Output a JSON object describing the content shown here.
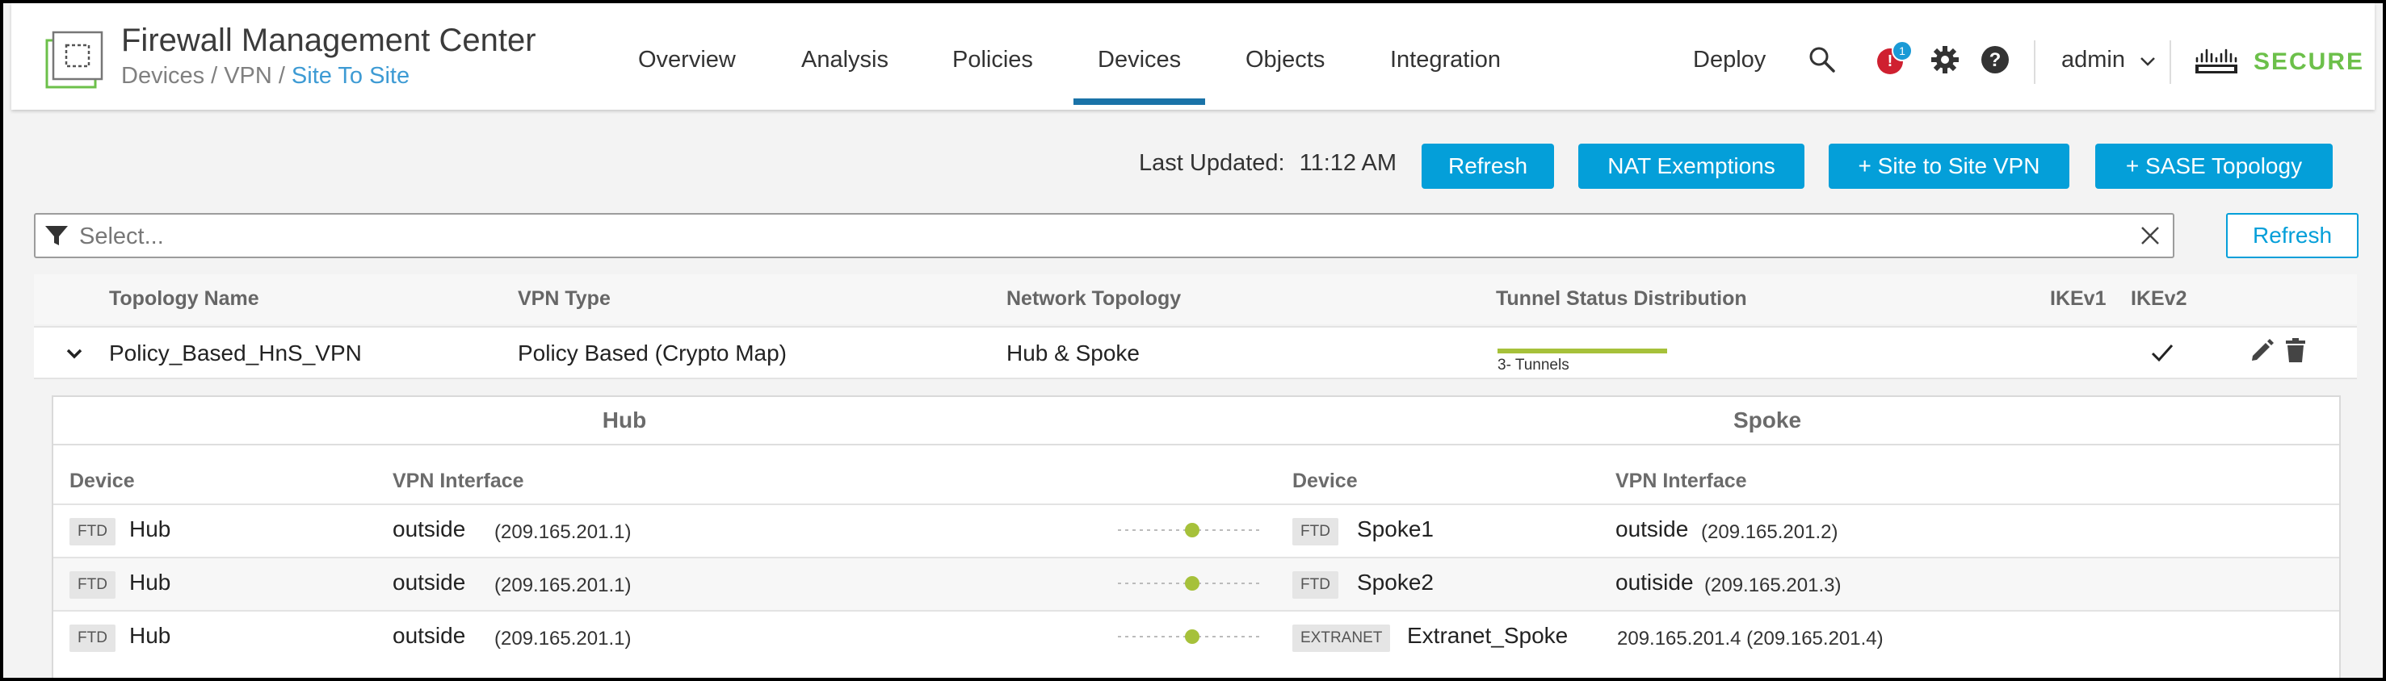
{
  "app": {
    "title": "Firewall Management Center",
    "breadcrumb": [
      "Devices",
      "VPN",
      "Site To Site"
    ]
  },
  "nav": {
    "items": [
      "Overview",
      "Analysis",
      "Policies",
      "Devices",
      "Objects",
      "Integration"
    ],
    "active": "Devices",
    "deploy": "Deploy",
    "alerts": {
      "icon": "!",
      "count": "1"
    },
    "user": "admin",
    "brand": "SECURE"
  },
  "toolbar": {
    "last_updated_label": "Last Updated:",
    "last_updated_time": "11:12 AM",
    "refresh": "Refresh",
    "nat_exemptions": "NAT Exemptions",
    "site_to_site": "+ Site to Site VPN",
    "sase_topology": "+ SASE Topology"
  },
  "filter": {
    "placeholder": "Select...",
    "refresh": "Refresh"
  },
  "table": {
    "columns": {
      "topology_name": "Topology Name",
      "vpn_type": "VPN Type",
      "network_topology": "Network Topology",
      "tunnel_status": "Tunnel Status Distribution",
      "ikev1": "IKEv1",
      "ikev2": "IKEv2"
    },
    "rows": [
      {
        "topology_name": "Policy_Based_HnS_VPN",
        "vpn_type": "Policy Based (Crypto Map)",
        "network_topology": "Hub & Spoke",
        "tunnel_label": "3- Tunnels",
        "tunnel_up_fraction": 1.0,
        "ikev2": true
      }
    ]
  },
  "detail": {
    "hub_heading": "Hub",
    "spoke_heading": "Spoke",
    "device_col": "Device",
    "vpn_col": "VPN Interface",
    "rows": [
      {
        "hub_tag": "FTD",
        "hub_name": "Hub",
        "hub_if": "outside",
        "hub_ip": "(209.165.201.1)",
        "spoke_tag": "FTD",
        "spoke_name": "Spoke1",
        "spoke_if": "outside",
        "spoke_ip": "(209.165.201.2)"
      },
      {
        "hub_tag": "FTD",
        "hub_name": "Hub",
        "hub_if": "outside",
        "hub_ip": "(209.165.201.1)",
        "spoke_tag": "FTD",
        "spoke_name": "Spoke2",
        "spoke_if": "outiside",
        "spoke_ip": "(209.165.201.3)"
      },
      {
        "hub_tag": "FTD",
        "hub_name": "Hub",
        "hub_if": "outside",
        "hub_ip": "(209.165.201.1)",
        "spoke_tag": "EXTRANET",
        "spoke_name": "Extranet_Spoke",
        "spoke_if": "",
        "spoke_ip": "209.165.201.4 (209.165.201.4)"
      }
    ]
  },
  "colors": {
    "primary": "#049fd9",
    "nav_active": "#1a73a8",
    "tunnel_ok": "#a6c13a",
    "brand_green": "#6cc04a",
    "alert": "#cf2030"
  }
}
